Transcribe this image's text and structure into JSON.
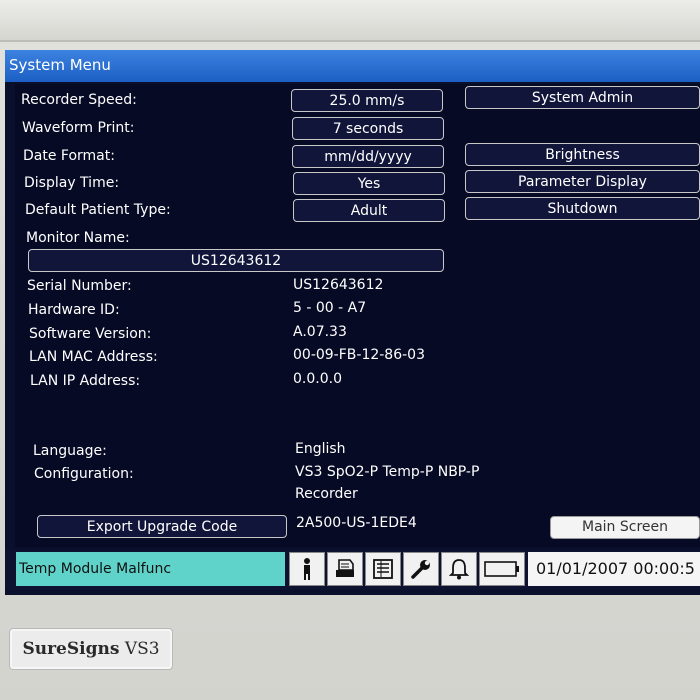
{
  "window": {
    "title": "System Menu"
  },
  "settings": [
    {
      "label": "Recorder Speed:",
      "value": "25.0 mm/s"
    },
    {
      "label": "Waveform Print:",
      "value": "7 seconds"
    },
    {
      "label": "Date Format:",
      "value": "mm/dd/yyyy"
    },
    {
      "label": "Display Time:",
      "value": "Yes"
    },
    {
      "label": "Default Patient Type:",
      "value": "Adult"
    }
  ],
  "side_buttons": {
    "system_admin": "System Admin",
    "brightness": "Brightness",
    "parameter_display": "Parameter Display",
    "shutdown": "Shutdown"
  },
  "monitor_name": {
    "label": "Monitor Name:",
    "value": "US12643612"
  },
  "info": [
    {
      "label": "Serial Number:",
      "value": "US12643612"
    },
    {
      "label": "Hardware ID:",
      "value": "5 - 00 - A7"
    },
    {
      "label": "Software Version:",
      "value": "A.07.33"
    },
    {
      "label": "LAN MAC Address:",
      "value": "00-09-FB-12-86-03"
    },
    {
      "label": "LAN IP Address:",
      "value": "0.0.0.0"
    }
  ],
  "language": {
    "label": "Language:",
    "value": "English"
  },
  "configuration": {
    "label": "Configuration:",
    "value_line1": "VS3 SpO2-P Temp-P NBP-P",
    "value_line2": "Recorder"
  },
  "upgrade": {
    "button": "Export Upgrade Code",
    "code": "2A500-US-1EDE4"
  },
  "main_screen_button": "Main Screen",
  "status_bar": {
    "alarm_message": "Temp Module Malfunc",
    "icons": [
      "patient-icon",
      "print-icon",
      "trend-icon",
      "wrench-icon",
      "alarm-bell-icon",
      "battery-icon"
    ],
    "datetime": "01/01/2007  00:00:5"
  },
  "brand": {
    "name": "SureSigns",
    "model": "VS3"
  }
}
